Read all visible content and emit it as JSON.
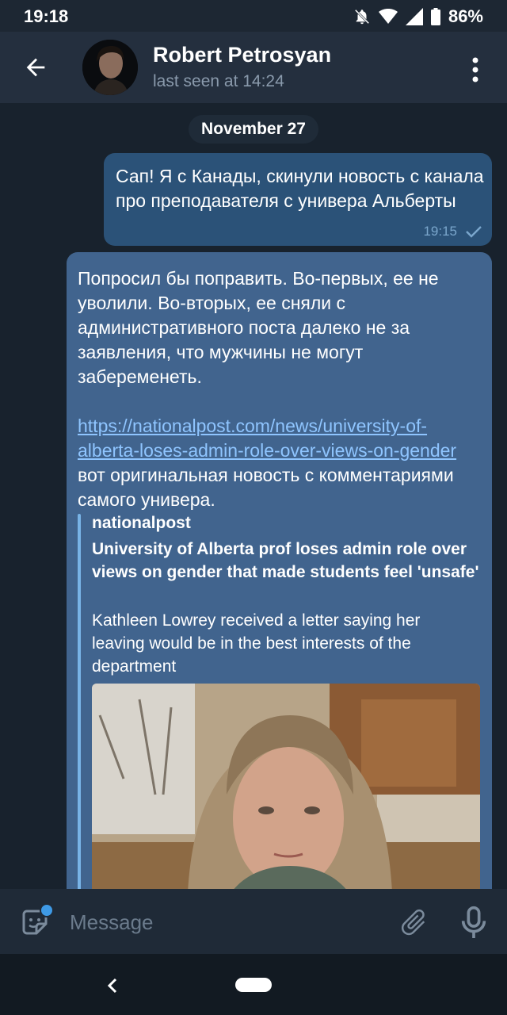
{
  "status_bar": {
    "time": "19:18",
    "battery": "86%"
  },
  "header": {
    "name": "Robert Petrosyan",
    "status": "last seen at 14:24"
  },
  "chat": {
    "date_label": "November 27",
    "outgoing": {
      "text": "Сап! Я с Канады, скинули новость с канала про преподавателя с универа Альберты",
      "time": "19:15"
    },
    "incoming": {
      "text_part1": "Попросил бы поправить. Во-первых, ее не уволили. Во-вторых, ее сняли с административного поста далеко не за заявления, что мужчины не могут забеременеть.",
      "link": "https://nationalpost.com/news/university-of-alberta-loses-admin-role-over-views-on-gender",
      "text_part2": " вот оригинальная новость с комментариями самого универа.",
      "preview": {
        "site": "nationalpost",
        "title": "University of Alberta prof loses admin role over views on gender that made students feel 'unsafe'",
        "description": "Kathleen Lowrey received a letter saying her leaving would be in the best interests of the department"
      }
    }
  },
  "input": {
    "placeholder": "Message"
  },
  "colors": {
    "outgoing_bubble": "#2b5278",
    "incoming_bubble": "#41648e",
    "link": "#8fc5ff"
  },
  "icons": [
    "back-arrow-icon",
    "more-vert-icon",
    "sticker-icon",
    "attach-icon",
    "mic-icon",
    "read-check-icon",
    "bell-off-icon",
    "wifi-icon",
    "signal-icon",
    "battery-icon"
  ]
}
